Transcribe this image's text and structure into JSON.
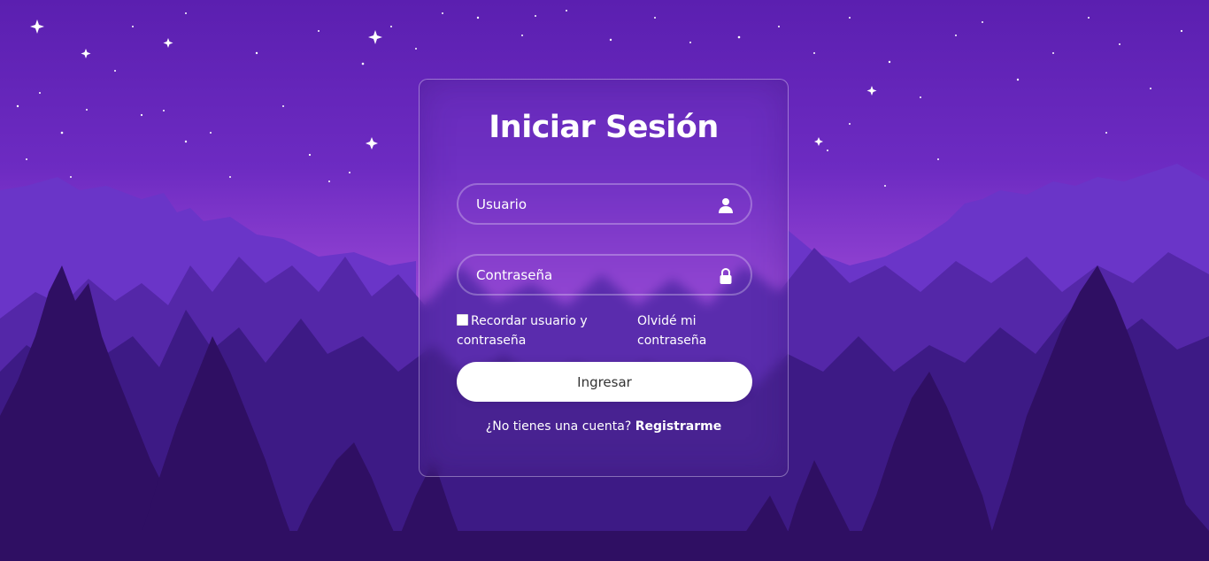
{
  "login": {
    "title": "Iniciar Sesión",
    "username_placeholder": "Usuario",
    "password_placeholder": "Contraseña",
    "remember_label": "Recordar usuario y contraseña",
    "remember_checked": false,
    "forgot_link": "Olvidé mi contraseña",
    "submit_label": "Ingresar",
    "register_prompt": "¿No tienes una cuenta?",
    "register_link": "Registrarme"
  },
  "icons": {
    "username": "user-icon",
    "password": "lock-icon"
  },
  "colors": {
    "sky_top": "#5b1fb0",
    "sky_glow": "#c36ee3",
    "mountains": "#6a35c8",
    "trees_dark": "#2f0f63",
    "button_bg": "#ffffff",
    "button_text": "#333333"
  }
}
